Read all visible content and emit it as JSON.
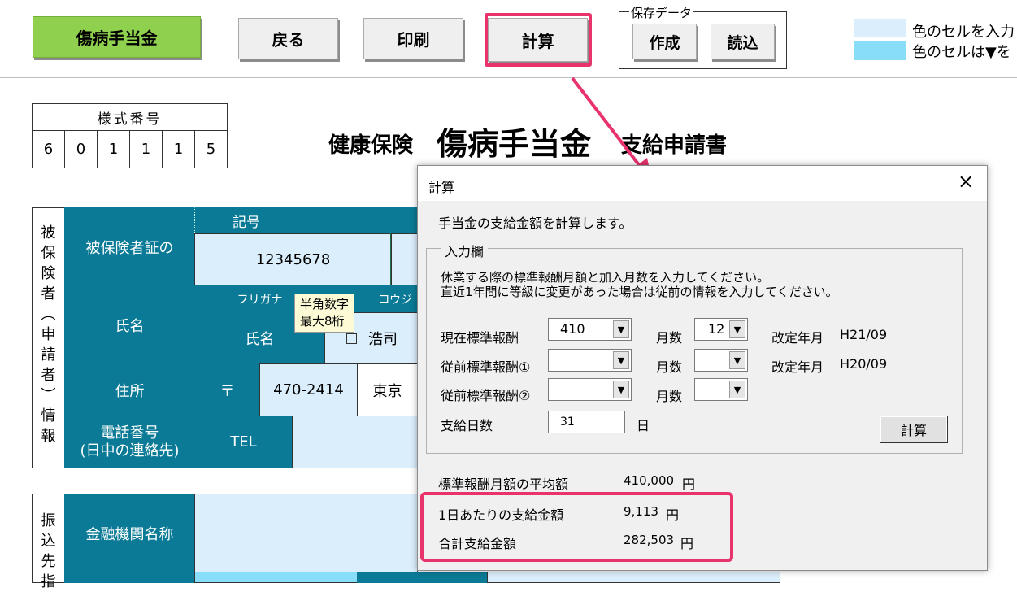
{
  "toolbar": {
    "title_btn": "傷病手当金",
    "back_btn": "戻る",
    "print_btn": "印刷",
    "calc_btn": "計算",
    "save_group_label": "保存データ",
    "create_btn": "作成",
    "load_btn": "読込",
    "legend1": "色のセルを入力",
    "legend2": "色のセルは▼を",
    "legend1_color": "#dbeefc",
    "legend2_color": "#88def8"
  },
  "form": {
    "style_label": "様式番号",
    "style_digits": [
      "6",
      "0",
      "1",
      "1",
      "1",
      "5"
    ],
    "title_prefix": "健康保険",
    "title_main": "傷病手当金",
    "title_suffix": "支給申請書",
    "section1_chars": [
      "被",
      "保",
      "険",
      "者",
      "︵",
      "申",
      "請",
      "者",
      "︶",
      "情",
      "報"
    ],
    "insured_card_label": "被保険者証の",
    "kigou_label": "記号",
    "kigou_value": "12345678",
    "furigana_label": "フリガナ",
    "furigana_extra": "コウジ",
    "name_label": "氏名",
    "name_field": "氏名",
    "name_value": "浩司",
    "address_label": "住所",
    "postal_mark": "〒",
    "postal_code": "470-2414",
    "address_value": "東京",
    "phone_label": "電話番号",
    "phone_sub": "(日中の連絡先)",
    "tel_label": "TEL",
    "section2_chars": [
      "振",
      "込",
      "先",
      "指"
    ],
    "bank_label": "金融機関名称",
    "tooltip_line1": "半角数字",
    "tooltip_line2": "最大8桁",
    "teal": "#0a7a96"
  },
  "dialog": {
    "title": "計算",
    "description": "手当金の支給金額を計算します。",
    "group_label": "入力欄",
    "instruction1": "休業する際の標準報酬月額と加入月数を入力してください。",
    "instruction2": "直近1年間に等級に変更があった場合は従前の情報を入力してください。",
    "rows": [
      {
        "label": "現在標準報酬",
        "value": "410",
        "months_label": "月数",
        "months": "12",
        "revision_label": "改定年月",
        "revision": "H21/09"
      },
      {
        "label": "従前標準報酬①",
        "value": "",
        "months_label": "月数",
        "months": "",
        "revision_label": "改定年月",
        "revision": "H20/09"
      },
      {
        "label": "従前標準報酬②",
        "value": "",
        "months_label": "月数",
        "months": "",
        "revision_label": "",
        "revision": ""
      }
    ],
    "days_label": "支給日数",
    "days_value": "31",
    "days_unit": "日",
    "calc_btn": "計算",
    "results": [
      {
        "label": "標準報酬月額の平均額",
        "value": "410,000",
        "unit": "円"
      },
      {
        "label": "1日あたりの支給金額",
        "value": "9,113",
        "unit": "円"
      },
      {
        "label": "合計支給金額",
        "value": "282,503",
        "unit": "円"
      }
    ],
    "close_icon": "×"
  }
}
